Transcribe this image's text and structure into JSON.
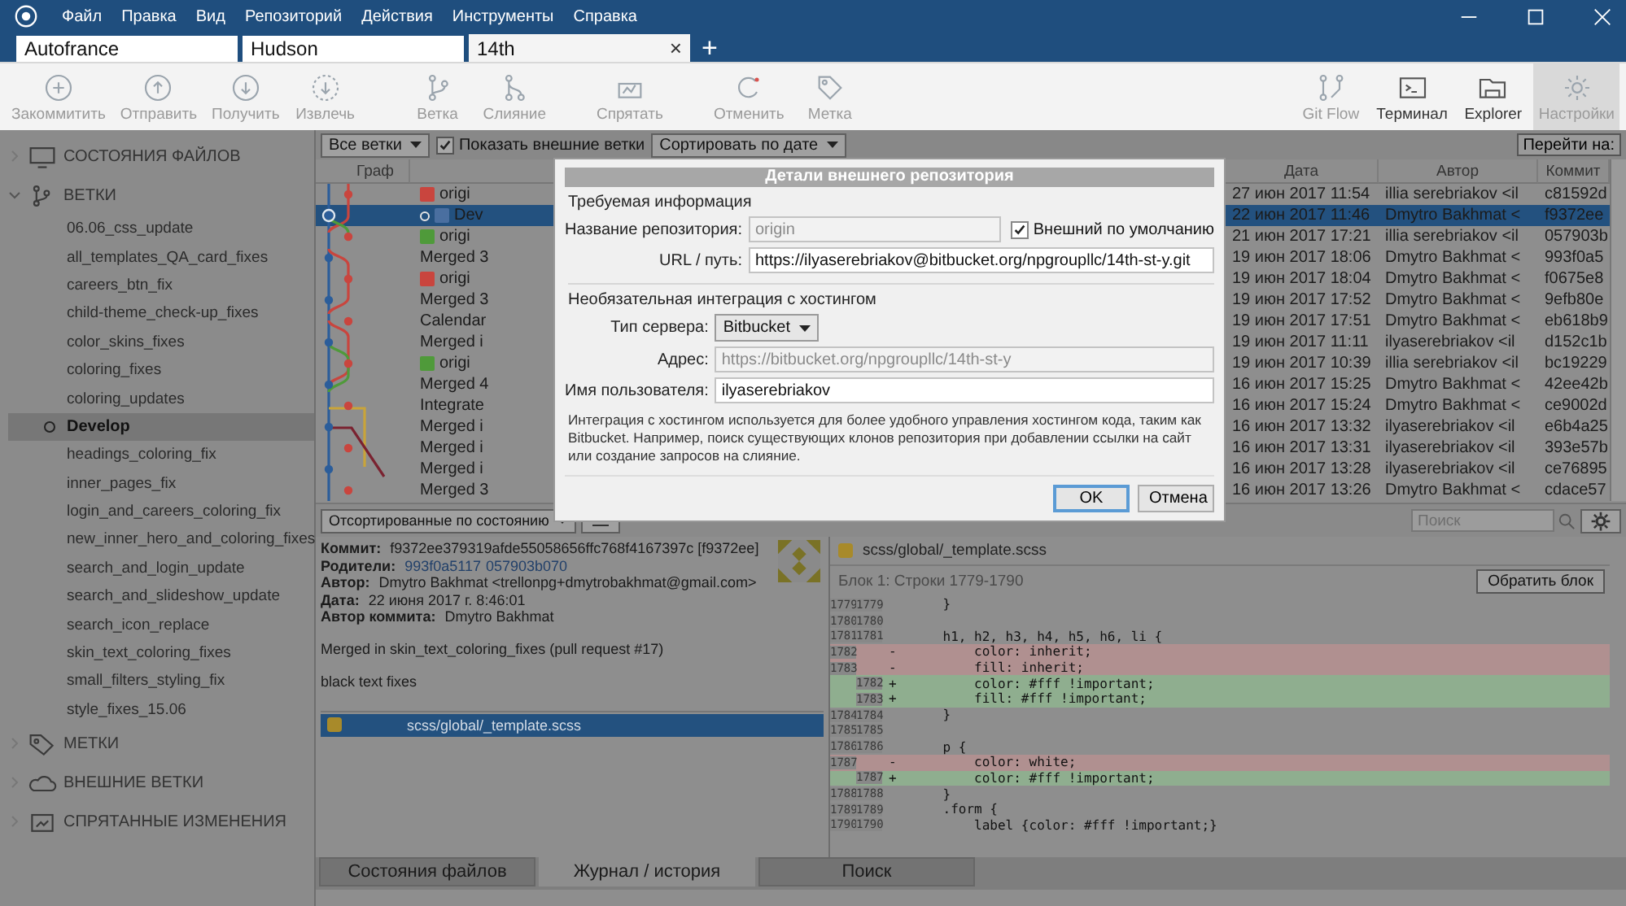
{
  "menu": [
    "Файл",
    "Правка",
    "Вид",
    "Репозиторий",
    "Действия",
    "Инструменты",
    "Справка"
  ],
  "repo_tabs": [
    {
      "label": "Autofrance",
      "selected": false
    },
    {
      "label": "Hudson",
      "selected": false
    },
    {
      "label": "14th",
      "selected": true,
      "close": "×"
    }
  ],
  "new_tab": "+",
  "toolbar": [
    {
      "kind": "commit",
      "label": "Закоммитить",
      "disabled": true,
      "active": false
    },
    {
      "kind": "push",
      "label": "Отправить",
      "disabled": true,
      "active": false
    },
    {
      "kind": "pull",
      "label": "Получить",
      "disabled": true,
      "active": false
    },
    {
      "kind": "fetch",
      "label": "Извлечь",
      "disabled": true,
      "active": false
    },
    {
      "kind": "branch",
      "label": "Ветка",
      "disabled": true,
      "active": false
    },
    {
      "kind": "merge",
      "label": "Слияние",
      "disabled": true,
      "active": false
    },
    {
      "kind": "stash",
      "label": "Спрятать",
      "disabled": true,
      "active": false
    },
    {
      "kind": "discard",
      "label": "Отменить",
      "disabled": true,
      "active": false
    },
    {
      "kind": "tag",
      "label": "Метка",
      "disabled": true,
      "active": false
    }
  ],
  "toolbar_right": [
    {
      "kind": "gitflow",
      "label": "Git Flow",
      "disabled": true,
      "active": false
    },
    {
      "kind": "terminal",
      "label": "Терминал",
      "disabled": false,
      "active": false
    },
    {
      "kind": "folder",
      "label": "Explorer",
      "disabled": false,
      "active": false
    },
    {
      "kind": "settings",
      "label": "Настройки",
      "disabled": true,
      "active": true
    }
  ],
  "sidebar": [
    {
      "kind": "files",
      "label": "СОСТОЯНИЯ ФАЙЛОВ",
      "expanded": false
    },
    {
      "kind": "branches",
      "label": "ВЕТКИ",
      "expanded": true,
      "children": [
        {
          "label": "06.06_css_update",
          "selected": false
        },
        {
          "label": "all_templates_QA_card_fixes",
          "selected": false
        },
        {
          "label": "careers_btn_fix",
          "selected": false
        },
        {
          "label": "child-theme_check-up_fixes",
          "selected": false
        },
        {
          "label": "color_skins_fixes",
          "selected": false
        },
        {
          "label": "coloring_fixes",
          "selected": false
        },
        {
          "label": "coloring_updates",
          "selected": false
        },
        {
          "label": "Develop",
          "selected": true
        },
        {
          "label": "headings_coloring_fix",
          "selected": false
        },
        {
          "label": "inner_pages_fix",
          "selected": false
        },
        {
          "label": "login_and_careers_coloring_fix",
          "selected": false
        },
        {
          "label": "new_inner_hero_and_coloring_fixes",
          "selected": false
        },
        {
          "label": "search_and_login_update",
          "selected": false
        },
        {
          "label": "search_and_slideshow_update",
          "selected": false
        },
        {
          "label": "search_icon_replace",
          "selected": false
        },
        {
          "label": "skin_text_coloring_fixes",
          "selected": false
        },
        {
          "label": "small_filters_styling_fix",
          "selected": false
        },
        {
          "label": "style_fixes_15.06",
          "selected": false
        }
      ]
    },
    {
      "kind": "tags",
      "label": "МЕТКИ",
      "expanded": false
    },
    {
      "kind": "remotes",
      "label": "ВНЕШНИЕ ВЕТКИ",
      "expanded": false
    },
    {
      "kind": "stashes",
      "label": "СПРЯТАННЫЕ ИЗМЕНЕНИЯ",
      "expanded": false
    }
  ],
  "filters": {
    "branches": "Все ветки",
    "show_remote": {
      "label": "Показать внешние ветки",
      "checked": true
    },
    "sort": "Сортировать по дате",
    "goto": "Перейти на:"
  },
  "columns": {
    "graph": "Граф",
    "date": "Дата",
    "author": "Автор",
    "commit": "Коммит"
  },
  "commits": [
    {
      "message": "origi",
      "color": "#c9453e",
      "current": false,
      "date": "27 июн 2017 11:54",
      "author": "illia serebriakov <il",
      "commit": "c81592d",
      "selected": false
    },
    {
      "message": "Dev",
      "color": "#4a6fa0",
      "current": true,
      "date": "22 июн 2017 11:46",
      "author": "Dmytro Bakhmat <",
      "commit": "f9372ee",
      "selected": true
    },
    {
      "message": "origi",
      "color": "#4f9a3a",
      "current": false,
      "date": "21 июн 2017 17:21",
      "author": "illia serebriakov <il",
      "commit": "057903b",
      "selected": false
    },
    {
      "message": "Merged 3",
      "current": false,
      "date": "19 июн 2017 18:06",
      "author": "Dmytro Bakhmat <",
      "commit": "993f0a5",
      "selected": false
    },
    {
      "message": "origi",
      "color": "#c9453e",
      "current": false,
      "date": "19 июн 2017 18:04",
      "author": "Dmytro Bakhmat <",
      "commit": "f0675e8",
      "selected": false
    },
    {
      "message": "Merged 3",
      "current": false,
      "date": "19 июн 2017 17:52",
      "author": "Dmytro Bakhmat <",
      "commit": "9efb80e",
      "selected": false
    },
    {
      "message": "Calendar",
      "current": false,
      "date": "19 июн 2017 17:51",
      "author": "Dmytro Bakhmat <",
      "commit": "eb618b9",
      "selected": false
    },
    {
      "message": "Merged i",
      "current": false,
      "date": "19 июн 2017 11:11",
      "author": "ilyaserebriakov <il",
      "commit": "d152c1b",
      "selected": false
    },
    {
      "message": "origi",
      "color": "#4f9a3a",
      "current": false,
      "date": "19 июн 2017 10:39",
      "author": "illia serebriakov <il",
      "commit": "bc19229",
      "selected": false
    },
    {
      "message": "Merged 4",
      "current": false,
      "date": "16 июн 2017 15:25",
      "author": "Dmytro Bakhmat <",
      "commit": "42ee42b",
      "selected": false
    },
    {
      "message": "Integrate",
      "current": false,
      "date": "16 июн 2017 15:24",
      "author": "Dmytro Bakhmat <",
      "commit": "ce9002d",
      "selected": false
    },
    {
      "message": "Merged i",
      "current": false,
      "date": "16 июн 2017 13:32",
      "author": "ilyaserebriakov <il",
      "commit": "e6b4a25",
      "selected": false
    },
    {
      "message": "Merged i",
      "current": false,
      "date": "16 июн 2017 13:31",
      "author": "ilyaserebriakov <il",
      "commit": "393e57b",
      "selected": false
    },
    {
      "message": "Merged i",
      "current": false,
      "date": "16 июн 2017 13:28",
      "author": "ilyaserebriakov <il",
      "commit": "ce76895",
      "selected": false
    },
    {
      "message": "Merged 3",
      "current": false,
      "date": "16 июн 2017 13:26",
      "author": "Dmytro Bakhmat <",
      "commit": "cdace57",
      "selected": false
    }
  ],
  "lower_toolbar": {
    "sort": "Отсортированные по состоянию",
    "search": {
      "placeholder": "Поиск"
    }
  },
  "details": {
    "fields": [
      {
        "label": "Коммит:",
        "value": "f9372ee379319afde55058656ffc768f4167397c [f9372ee]"
      },
      {
        "label": "Родители:",
        "links": [
          "993f0a5117",
          "057903b070"
        ]
      },
      {
        "label": "Автор:",
        "value": "Dmytro Bakhmat <trellonpg+dmytrobakhmat@gmail.com>"
      },
      {
        "label": "Дата:",
        "value": "22 июня 2017 г. 8:46:01"
      },
      {
        "label": "Автор коммита:",
        "value": "Dmytro Bakhmat"
      }
    ],
    "message": [
      "Merged in skin_text_coloring_fixes (pull request #17)",
      "black text fixes"
    ],
    "files": [
      {
        "path": "scss/global/_template.scss",
        "selected": true
      }
    ]
  },
  "diff": {
    "file": "scss/global/_template.scss",
    "hunk": "Блок 1: Строки 1779-1790",
    "reverse": "Обратить блок",
    "lines": [
      {
        "kind": "context",
        "old": "1779",
        "new": "1779",
        "code": "    }"
      },
      {
        "kind": "context",
        "old": "1780",
        "new": "1780"
      },
      {
        "kind": "context",
        "old": "1781",
        "new": "1781",
        "code": "    h1, h2, h3, h4, h5, h6, li {"
      },
      {
        "kind": "removed",
        "old": "1782",
        "sign": "-",
        "code": "        color: inherit;"
      },
      {
        "kind": "removed",
        "old": "1783",
        "sign": "-",
        "code": "        fill: inherit;"
      },
      {
        "kind": "added",
        "new": "1782",
        "sign": "+",
        "code": "        color: #fff !important;"
      },
      {
        "kind": "added",
        "new": "1783",
        "sign": "+",
        "code": "        fill: #fff !important;"
      },
      {
        "kind": "context",
        "old": "1784",
        "new": "1784",
        "code": "    }"
      },
      {
        "kind": "context",
        "old": "1785",
        "new": "1785"
      },
      {
        "kind": "context",
        "old": "1786",
        "new": "1786",
        "code": "    p {"
      },
      {
        "kind": "removed",
        "old": "1787",
        "sign": "-",
        "code": "        color: white;"
      },
      {
        "kind": "added",
        "new": "1787",
        "sign": "+",
        "code": "        color: #fff !important;"
      },
      {
        "kind": "context",
        "old": "1788",
        "new": "1788",
        "code": "    }"
      },
      {
        "kind": "context",
        "old": "1789",
        "new": "1789",
        "code": "    .form {"
      },
      {
        "kind": "context",
        "old": "1790",
        "new": "1790",
        "code": "        label {color: #fff !important;}"
      }
    ]
  },
  "bottom_tabs": [
    {
      "label": "Состояния файлов",
      "selected": false
    },
    {
      "label": "Журнал / история",
      "selected": true
    },
    {
      "label": "Поиск",
      "selected": false
    }
  ],
  "dialog": {
    "title": "Детали внешнего репозитория",
    "required": "Требуемая информация",
    "name": {
      "label": "Название репозитория:",
      "value": "origin",
      "disabled": true
    },
    "default_remote": {
      "label": "Внешний по умолчанию",
      "checked": true
    },
    "url": {
      "label": "URL / путь:",
      "value": "https://ilyaserebriakov@bitbucket.org/npgroupllc/14th-st-y.git",
      "disabled": false
    },
    "optional": "Необязательная интеграция с хостингом",
    "server": {
      "label": "Тип сервера:",
      "value": "Bitbucket"
    },
    "address": {
      "label": "Адрес:",
      "value": "https://bitbucket.org/npgroupllc/14th-st-y",
      "disabled": true
    },
    "user": {
      "label": "Имя пользователя:",
      "value": "ilyaserebriakov",
      "disabled": false
    },
    "note": "Интеграция с хостингом используется для более удобного управления хостингом кода, таким как Bitbucket. Например, поиск существующих клонов репозитория при добавлении ссылки на сайт или создание запросов на слияние.",
    "ok": "OK",
    "cancel": "Отмена"
  }
}
